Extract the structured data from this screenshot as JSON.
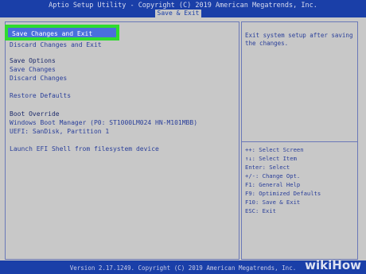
{
  "header": {
    "title": "Aptio Setup Utility - Copyright (C) 2019 American Megatrends, Inc.",
    "active_tab": "Save & Exit"
  },
  "main": {
    "selected_item": "Save Changes and Exit",
    "hidden_item": "Discard Changes and Exit",
    "save_options_heading": "Save Options",
    "save_changes": "Save Changes",
    "discard_changes": "Discard Changes",
    "restore_defaults": "Restore Defaults",
    "boot_override_heading": "Boot Override",
    "boot_option_1": "Windows Boot Manager (P0: ST1000LM024 HN-M101MBB)",
    "boot_option_2": "UEFI: SanDisk, Partition 1",
    "launch_efi": "Launch EFI Shell from filesystem device"
  },
  "help": {
    "line1": "Exit system setup after saving",
    "line2": "the changes."
  },
  "keys": [
    "++: Select Screen",
    "↑↓: Select Item",
    "Enter: Select",
    "+/-: Change Opt.",
    "F1: General Help",
    "F9: Optimized Defaults",
    "F10: Save & Exit",
    "ESC: Exit"
  ],
  "footer": {
    "text": "Version 2.17.1249. Copyright (C) 2019 American Megatrends, Inc."
  },
  "watermark": "wikiHow",
  "colors": {
    "bios_blue": "#1a3fa8",
    "panel_gray": "#c8c8c8",
    "highlight": "#4a6fdc",
    "focus_outline": "#2fdc2f"
  }
}
